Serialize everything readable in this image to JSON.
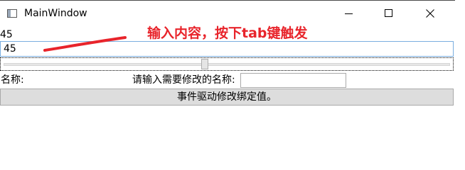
{
  "window": {
    "title": "MainWindow",
    "icon": "app-window-icon"
  },
  "controls": {
    "minimize_icon": "minimize-icon",
    "maximize_icon": "maximize-icon",
    "close_icon": "close-icon"
  },
  "binding_demo": {
    "echo_text": "45",
    "input_value": "45",
    "annotation": "输入内容，按下tab键触发",
    "annotation_color": "#e8242b"
  },
  "slider": {
    "value_fraction": 0.45
  },
  "name_row": {
    "name_label": "名称:",
    "name_value": "",
    "prompt_label": "请输入需要修改的名称:",
    "input_value": ""
  },
  "action_button": {
    "label": "事件驱动修改绑定值。"
  }
}
